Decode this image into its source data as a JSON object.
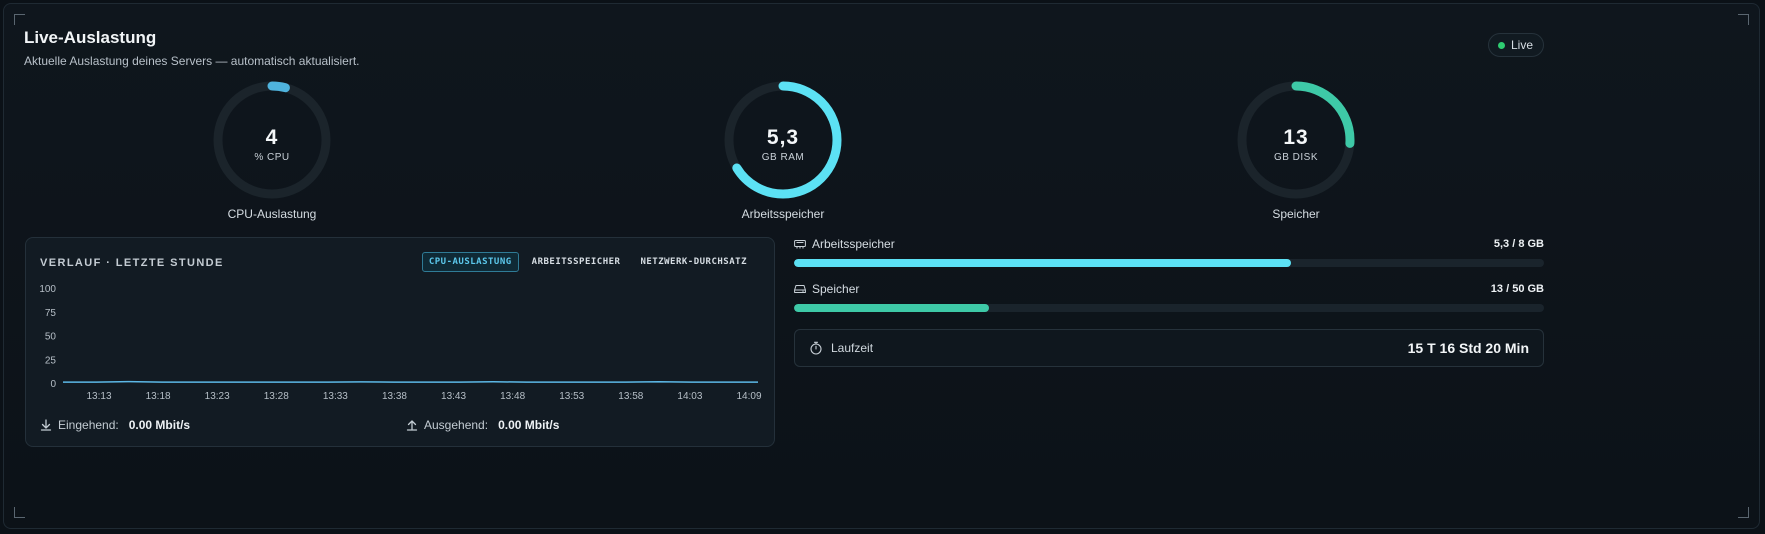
{
  "header": {
    "title": "Live-Auslastung",
    "subtitle": "Aktuelle Auslastung deines Servers — automatisch aktualisiert.",
    "live_label": "Live"
  },
  "gauges": [
    {
      "value": "4",
      "unit": "% CPU",
      "label": "CPU-Auslastung",
      "fraction": 0.04,
      "color": "#4fb3dd"
    },
    {
      "value": "5,3",
      "unit": "GB RAM",
      "label": "Arbeitsspeicher",
      "fraction": 0.6625,
      "color": "#5ce1f4"
    },
    {
      "value": "13",
      "unit": "GB DISK",
      "label": "Speicher",
      "fraction": 0.26,
      "color": "#3ec9a7"
    }
  ],
  "history": {
    "title": "VERLAUF · LETZTE STUNDE",
    "tabs": [
      {
        "label": "CPU-AUSLASTUNG",
        "active": true
      },
      {
        "label": "ARBEITSSPEICHER",
        "active": false
      },
      {
        "label": "NETZWERK-DURCHSATZ",
        "active": false
      }
    ],
    "incoming_label": "Eingehend:",
    "incoming_value": "0.00 Mbit/s",
    "outgoing_label": "Ausgehend:",
    "outgoing_value": "0.00 Mbit/s"
  },
  "chart_data": {
    "type": "line",
    "ylim": [
      0,
      100
    ],
    "yticks": [
      "100",
      "75",
      "50",
      "25",
      "0"
    ],
    "x": [
      "13:13",
      "13:18",
      "13:23",
      "13:28",
      "13:33",
      "13:38",
      "13:43",
      "13:48",
      "13:53",
      "13:58",
      "14:03",
      "14:09"
    ],
    "series": [
      {
        "values": [
          2,
          2,
          2.5,
          2,
          2,
          2,
          2,
          2,
          2,
          2.2,
          2,
          2,
          2,
          2.3,
          2,
          2,
          2,
          2,
          2.4,
          2,
          2,
          2
        ]
      }
    ],
    "line_color": "#5cb8e6"
  },
  "resources": {
    "memory": {
      "label": "Arbeitsspeicher",
      "value": "5,3 / 8 GB",
      "fraction": 0.6625,
      "color": "#5ce1f4"
    },
    "disk": {
      "label": "Speicher",
      "value": "13 / 50 GB",
      "fraction": 0.26,
      "color": "#3ec9a7"
    }
  },
  "uptime": {
    "label": "Laufzeit",
    "value": "15 T 16 Std 20 Min"
  }
}
